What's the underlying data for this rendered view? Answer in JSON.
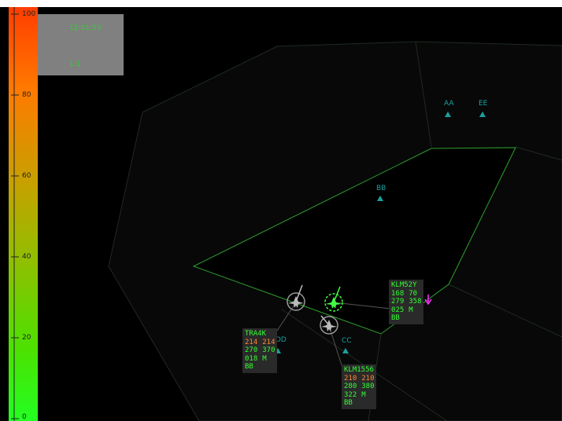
{
  "scale": {
    "ticks": [
      "100",
      "80",
      "60",
      "40",
      "20",
      "0"
    ]
  },
  "info": {
    "time": "12:01:53",
    "ratio": "1:1"
  },
  "waypoints": {
    "aa": "AA",
    "ee": "EE",
    "bb": "BB",
    "dd": "DD",
    "cc": "CC"
  },
  "tags": {
    "tra4k": {
      "callsign": "TRA4K",
      "r1a": "214",
      "r1b": "214",
      "r2a": "270",
      "r2b": "370",
      "r3a": "018",
      "r3b": "M",
      "r4": "BB"
    },
    "klm52y": {
      "callsign": "KLM52Y",
      "r1a": "168",
      "r1b": "70",
      "r2a": "279",
      "r2b": "358",
      "r3a": "025",
      "r3b": "M",
      "r4": "BB"
    },
    "klm1556": {
      "callsign": "KLM1556",
      "r1a": "210",
      "r1b": "210",
      "r2a": "280",
      "r2b": "380",
      "r3a": "322",
      "r3b": "M",
      "r4": "BB"
    }
  },
  "colors": {
    "sector_line": "#1f2a1f",
    "active_sector": "#2ea02e",
    "waypoint": "#1aa0a0",
    "tag_green": "#33ff33",
    "tag_orange": "#ff8833",
    "selected_aircraft": "#44ff44",
    "descent_arrow": "#ff33ff"
  }
}
